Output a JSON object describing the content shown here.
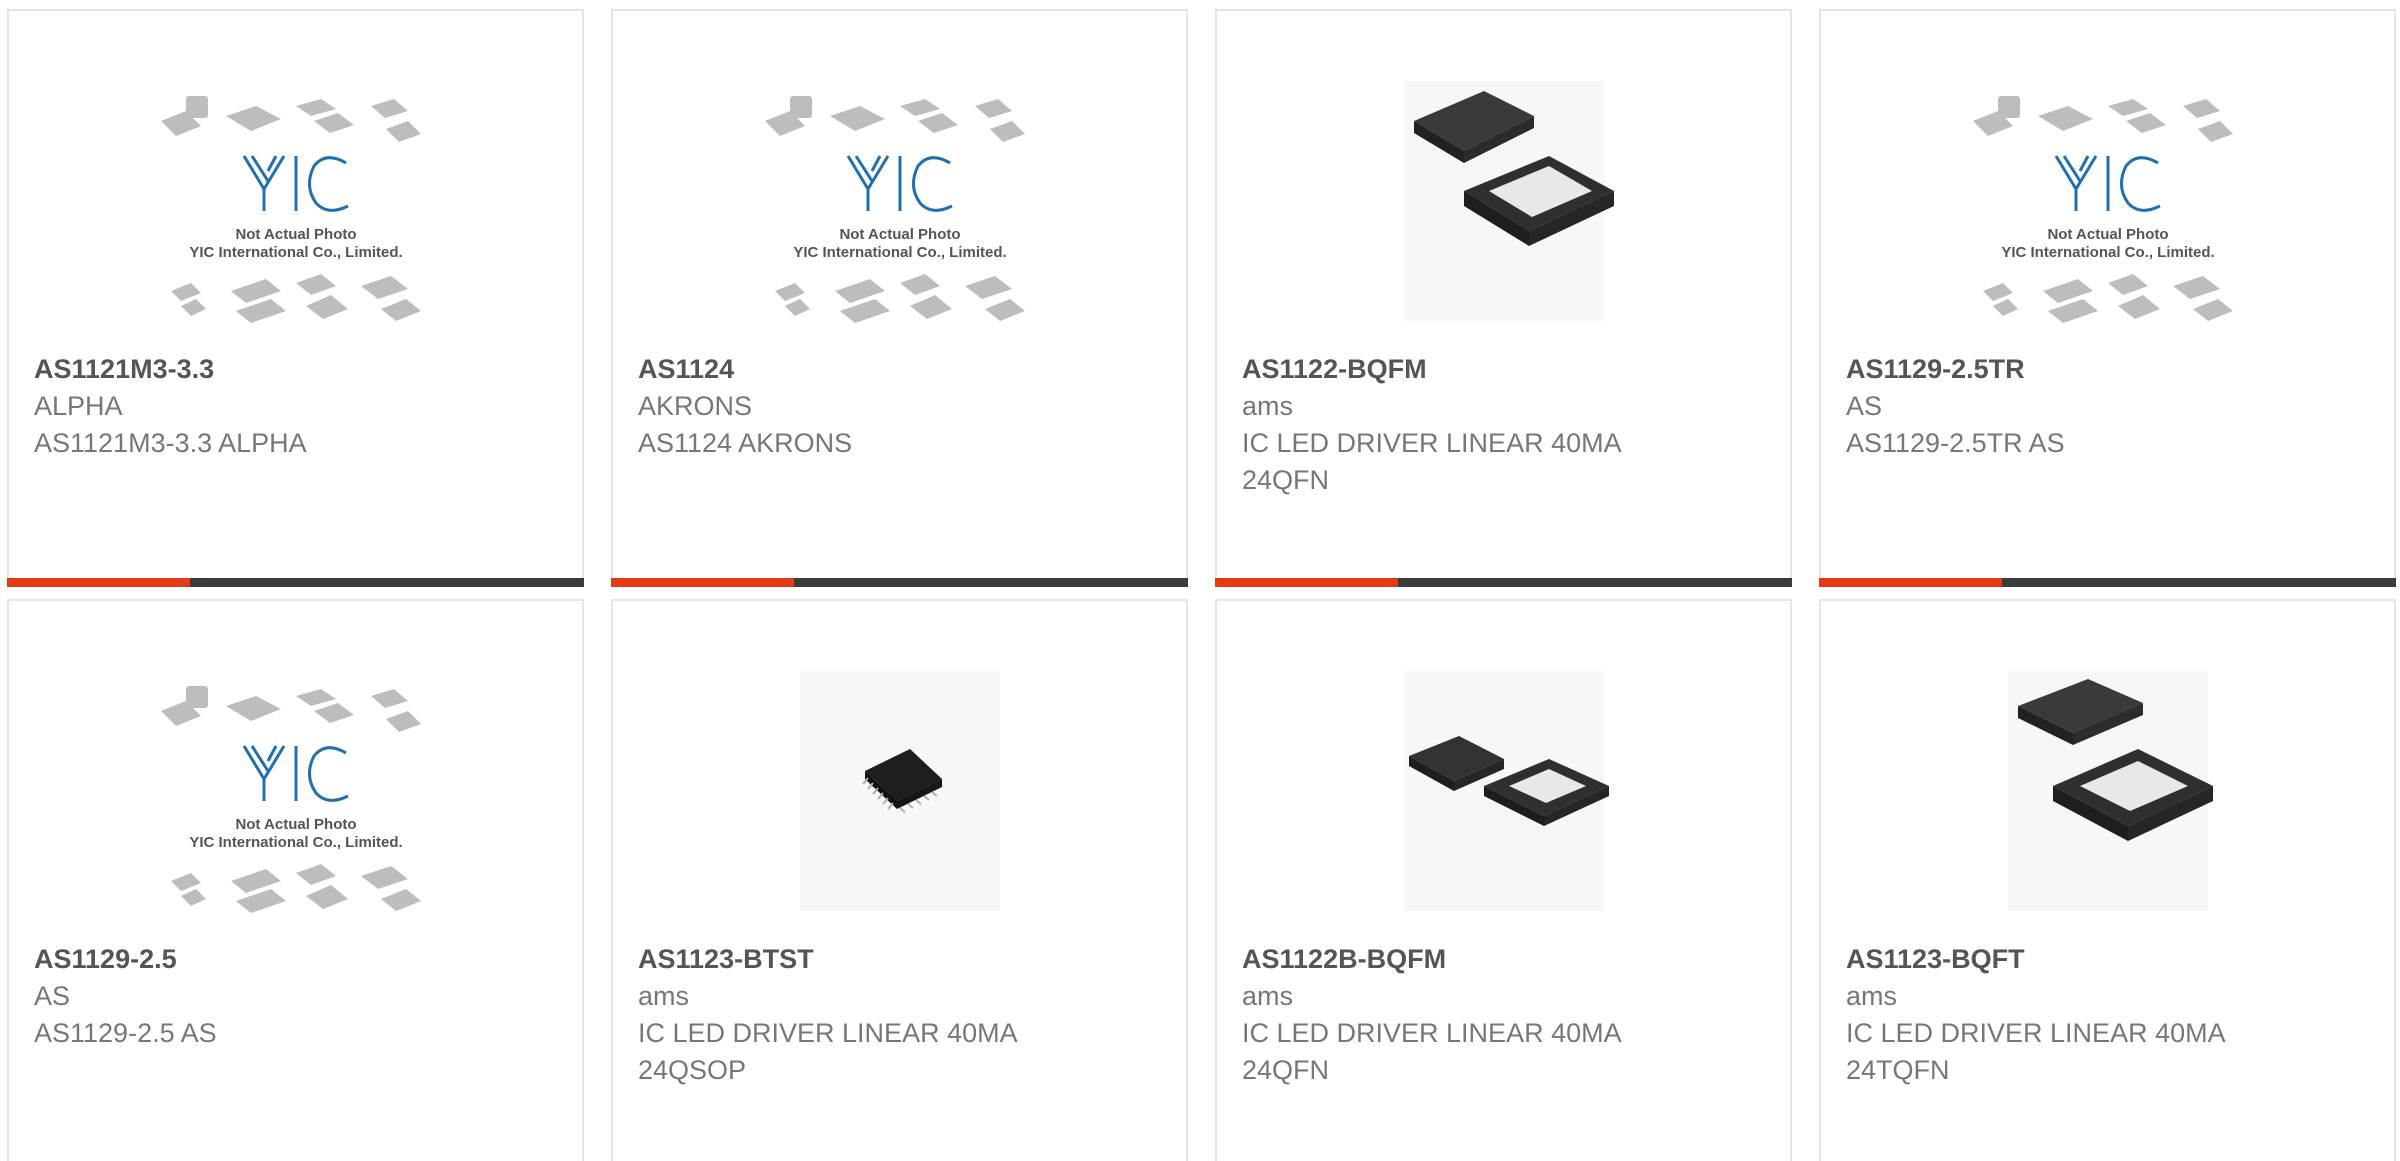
{
  "placeholder": {
    "logo_text": "YIC",
    "line1": "Not Actual Photo",
    "line2": "YIC International Co., Limited."
  },
  "colors": {
    "accent": "#e33b14",
    "bar": "#3b3b3b",
    "logo_blue": "#1f6fb3"
  },
  "products": [
    {
      "part": "AS1121M3-3.3",
      "brand": "ALPHA",
      "desc": "AS1121M3-3.3 ALPHA",
      "image": "placeholder"
    },
    {
      "part": "AS1124",
      "brand": "AKRONS",
      "desc": "AS1124 AKRONS",
      "image": "placeholder"
    },
    {
      "part": "AS1122-BQFM",
      "brand": "ams",
      "desc": "IC LED DRIVER LINEAR 40MA 24QFN",
      "image": "qfn-chip"
    },
    {
      "part": "AS1129-2.5TR",
      "brand": "AS",
      "desc": "AS1129-2.5TR AS",
      "image": "placeholder"
    },
    {
      "part": "AS1129-2.5",
      "brand": "AS",
      "desc": "AS1129-2.5 AS",
      "image": "placeholder"
    },
    {
      "part": "AS1123-BTST",
      "brand": "ams",
      "desc": "IC LED DRIVER LINEAR 40MA 24QSOP",
      "image": "qsop-chip"
    },
    {
      "part": "AS1122B-BQFM",
      "brand": "ams",
      "desc": "IC LED DRIVER LINEAR 40MA 24QFN",
      "image": "qfn-chip"
    },
    {
      "part": "AS1123-BQFT",
      "brand": "ams",
      "desc": "IC LED DRIVER LINEAR 40MA 24TQFN",
      "image": "qfn-chip"
    }
  ]
}
